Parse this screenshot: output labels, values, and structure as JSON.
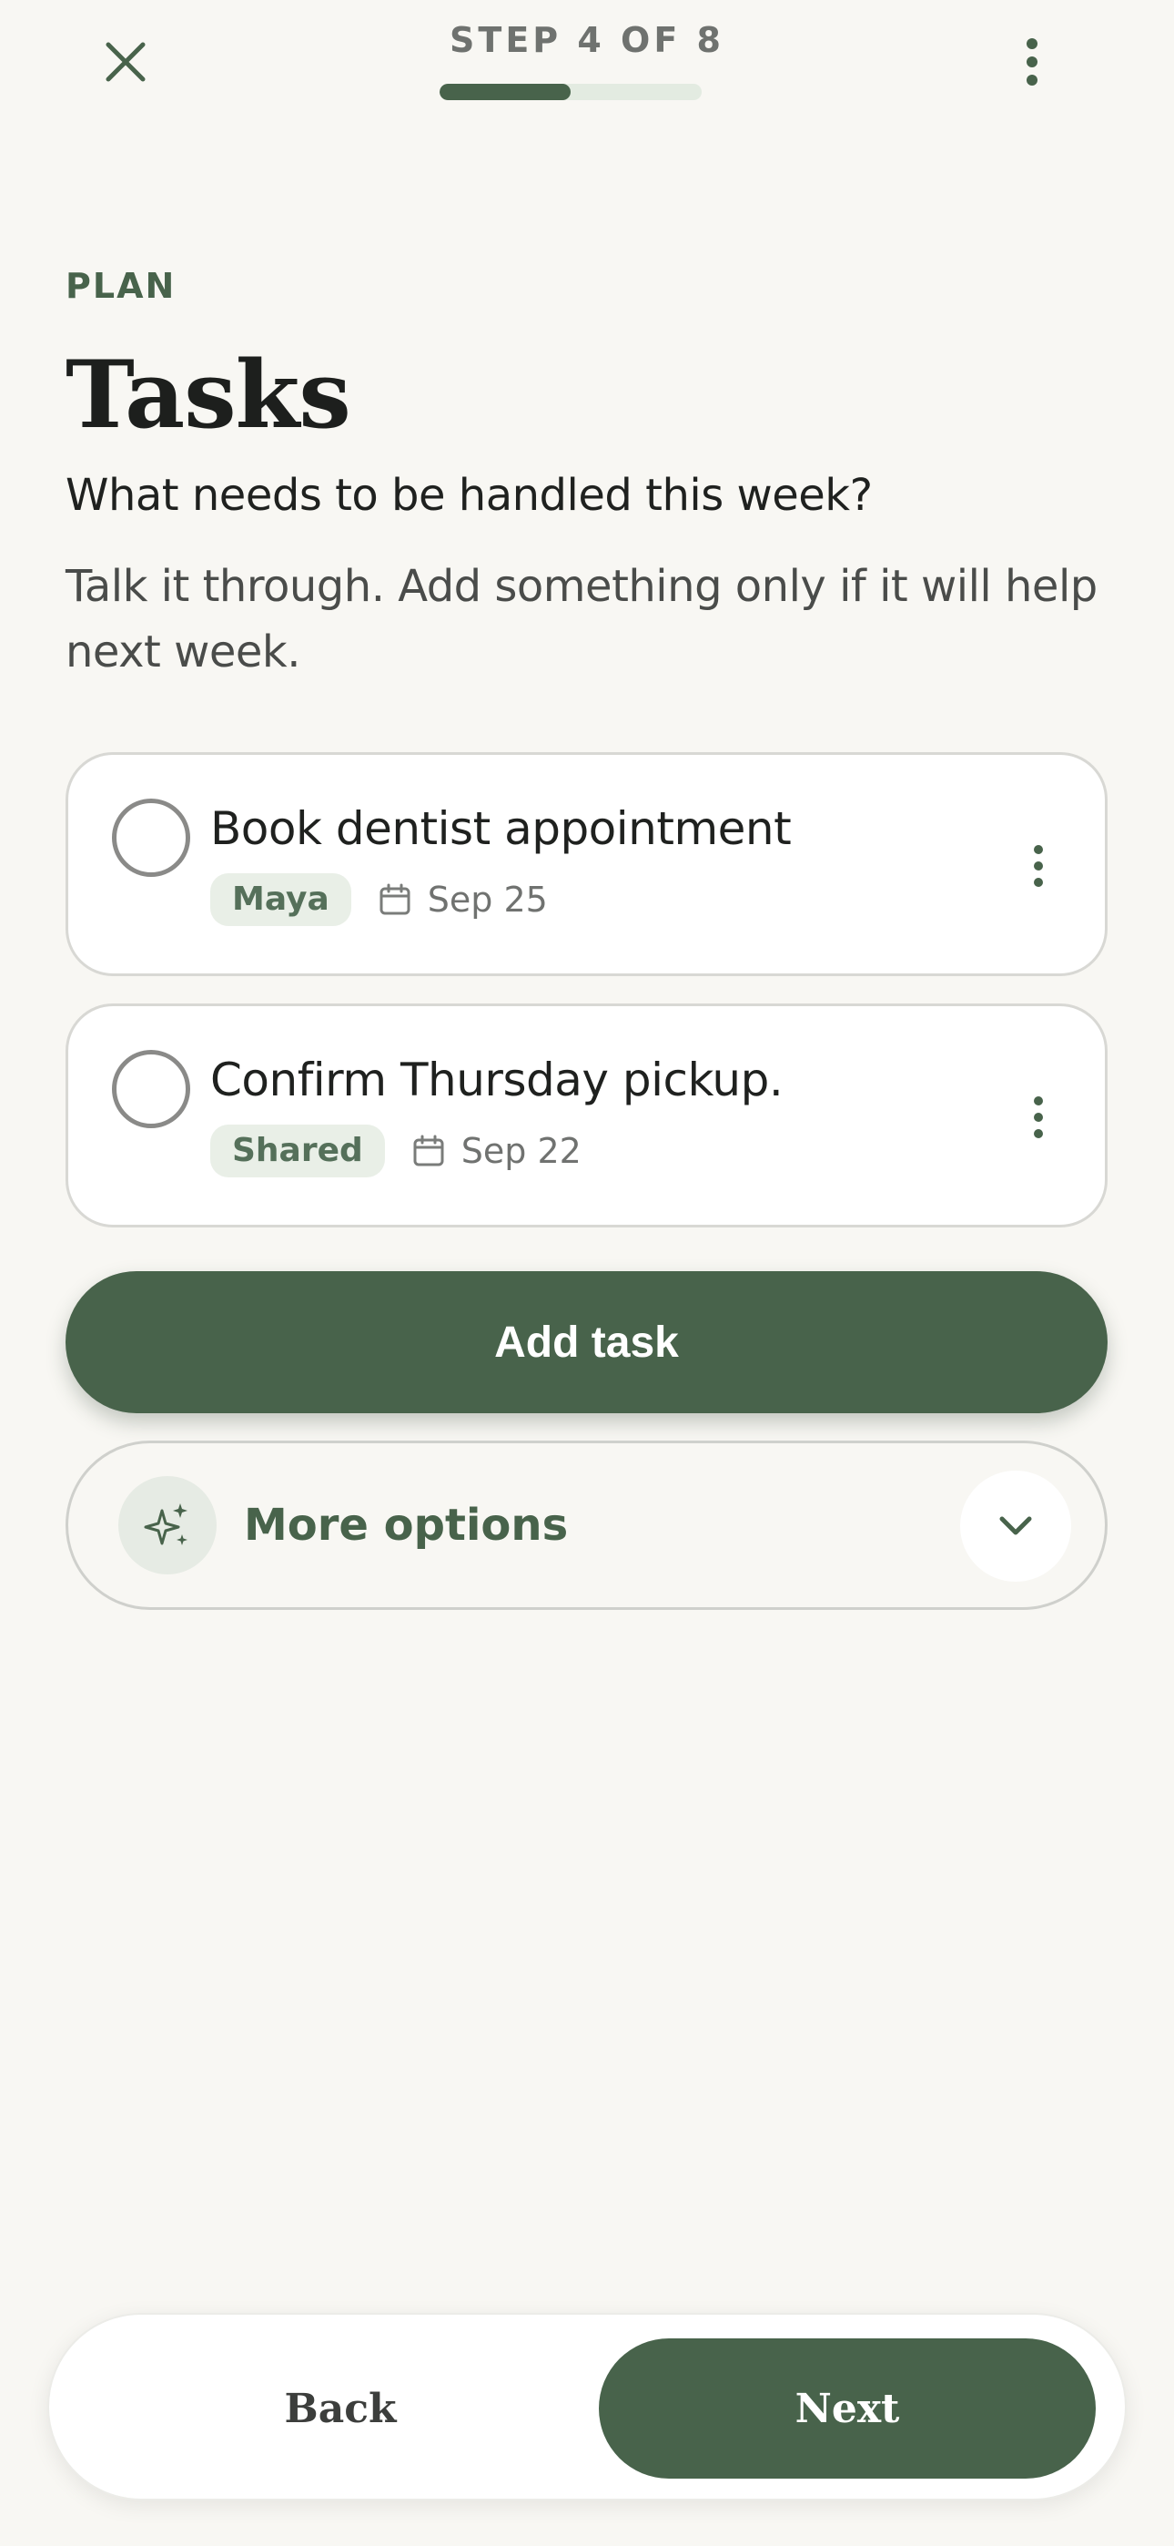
{
  "header": {
    "step_label": "STEP 4 OF 8",
    "progress_fraction": 0.5,
    "close_icon": "close-icon",
    "menu_icon": "more-vertical-icon"
  },
  "section": {
    "eyebrow": "PLAN",
    "title": "Tasks",
    "question": "What needs to be handled this week?",
    "helper": "Talk it through. Add something only if it will help next week."
  },
  "tasks": [
    {
      "title": "Book dentist appointment",
      "assignee": "Maya",
      "date": "Sep 25",
      "completed": false
    },
    {
      "title": "Confirm Thursday pickup.",
      "assignee": "Shared",
      "date": "Sep 22",
      "completed": false
    }
  ],
  "actions": {
    "add_task": "Add task",
    "more_options": "More options"
  },
  "nav": {
    "back": "Back",
    "next": "Next"
  },
  "colors": {
    "accent": "#48634b",
    "background": "#f8f7f3",
    "chip_bg": "#e9efe7"
  }
}
